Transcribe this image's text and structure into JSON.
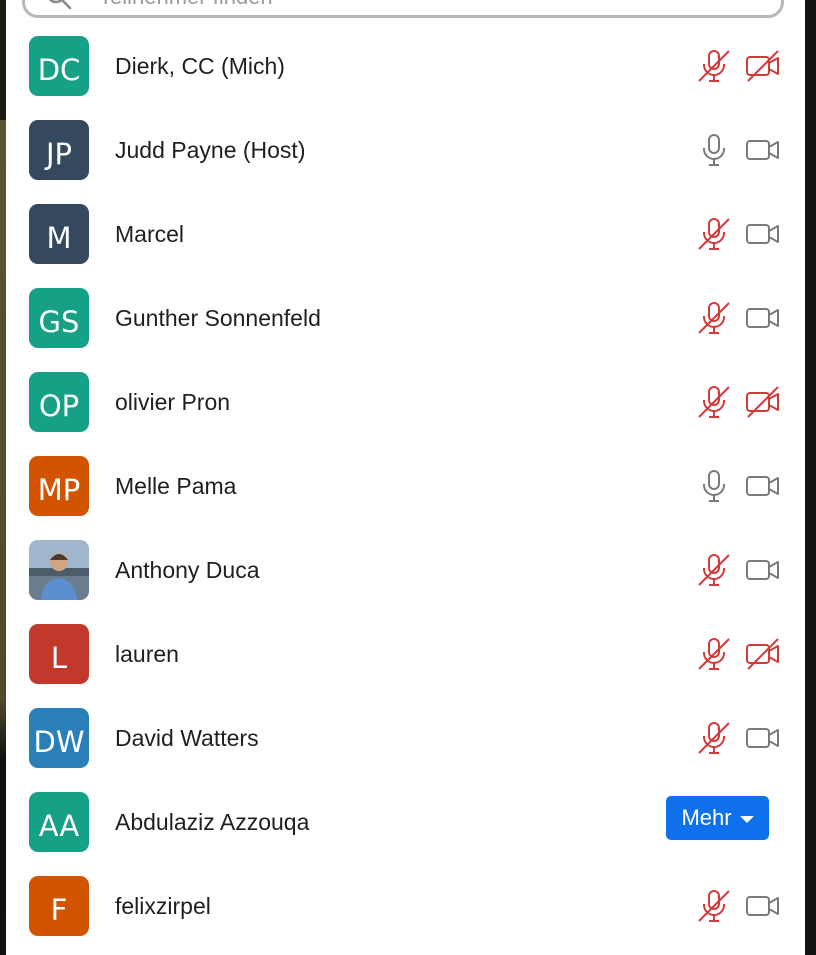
{
  "search": {
    "placeholder": "Teilnehmer finden"
  },
  "colors": {
    "muted": "#d33a3a",
    "active_icon": "#7a7a7a",
    "more_button": "#0e71eb"
  },
  "participants": [
    {
      "initials": "DC",
      "name": "Dierk, CC (Mich)",
      "avatar_color": "#16a085",
      "mic": "muted",
      "video": "off"
    },
    {
      "initials": "JP",
      "name": "Judd Payne (Host)",
      "avatar_color": "#34495e",
      "mic": "on",
      "video": "on"
    },
    {
      "initials": "M",
      "name": "Marcel",
      "avatar_color": "#34495e",
      "mic": "muted",
      "video": "on"
    },
    {
      "initials": "GS",
      "name": "Gunther Sonnenfeld",
      "avatar_color": "#16a085",
      "mic": "muted",
      "video": "on"
    },
    {
      "initials": "OP",
      "name": "olivier Pron",
      "avatar_color": "#16a085",
      "mic": "muted",
      "video": "off"
    },
    {
      "initials": "MP",
      "name": "Melle Pama",
      "avatar_color": "#d35400",
      "mic": "on",
      "video": "on"
    },
    {
      "initials": "",
      "name": "Anthony Duca",
      "avatar_color": "#8fa6bd",
      "avatar_photo": true,
      "mic": "muted",
      "video": "on"
    },
    {
      "initials": "L",
      "name": "lauren",
      "avatar_color": "#c0392b",
      "mic": "muted",
      "video": "off"
    },
    {
      "initials": "DW",
      "name": "David Watters",
      "avatar_color": "#2980b9",
      "mic": "muted",
      "video": "on"
    },
    {
      "initials": "AA",
      "name": "Abdulaziz Azzouqa",
      "avatar_color": "#16a085",
      "more_button": "Mehr"
    },
    {
      "initials": "F",
      "name": "felixzirpel",
      "avatar_color": "#d35400",
      "mic": "muted",
      "video": "on"
    }
  ]
}
